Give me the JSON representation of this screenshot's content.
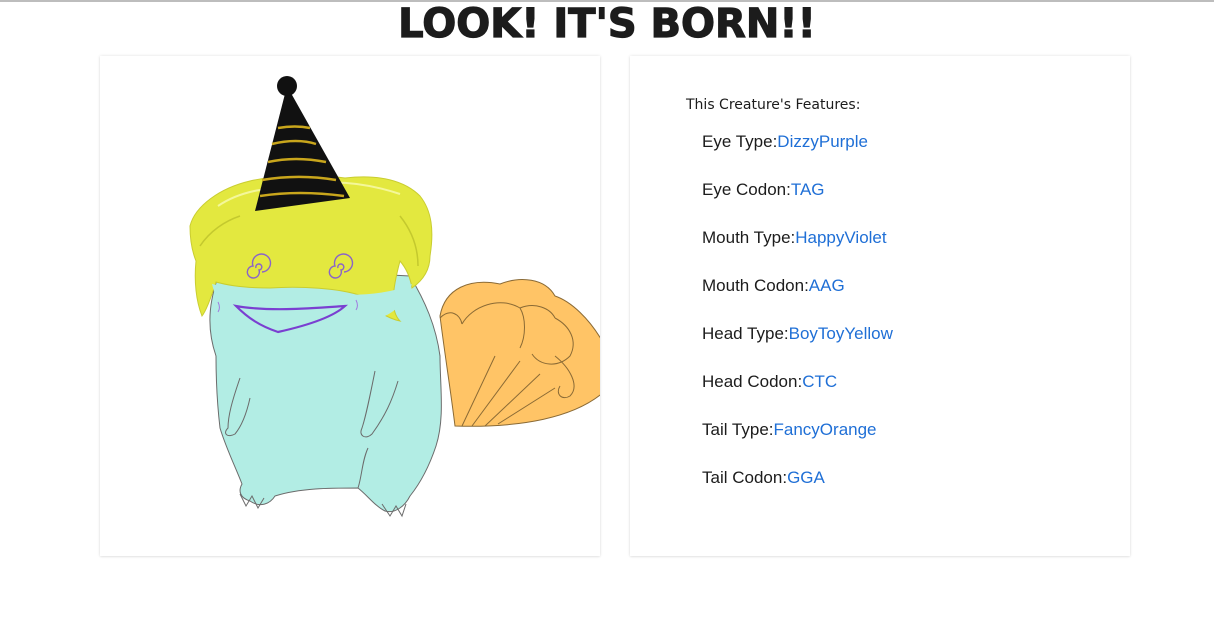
{
  "page": {
    "title": "LOOK! IT'S BORN!!"
  },
  "features": {
    "heading": "This Creature's Features:",
    "items": [
      {
        "label": "Eye Type:",
        "value": "DizzyPurple"
      },
      {
        "label": "Eye Codon:",
        "value": "TAG"
      },
      {
        "label": "Mouth Type:",
        "value": "HappyViolet"
      },
      {
        "label": "Mouth Codon:",
        "value": "AAG"
      },
      {
        "label": "Head Type:",
        "value": "BoyToyYellow"
      },
      {
        "label": "Head Codon:",
        "value": "CTC"
      },
      {
        "label": "Tail Type:",
        "value": "FancyOrange"
      },
      {
        "label": "Tail Codon:",
        "value": "GGA"
      }
    ]
  },
  "colors": {
    "title": "#1c1c1c",
    "value_link": "#1f6fd6",
    "body": "#b2ede4",
    "hair": "#e3e83f",
    "tail": "#ffc466",
    "mouth": "#7a3fd1",
    "eyes": "#8a63c9",
    "hat": "#111111",
    "hat_stripes": "#c9a61c"
  },
  "icons": {
    "creature": "creature-illustration"
  }
}
